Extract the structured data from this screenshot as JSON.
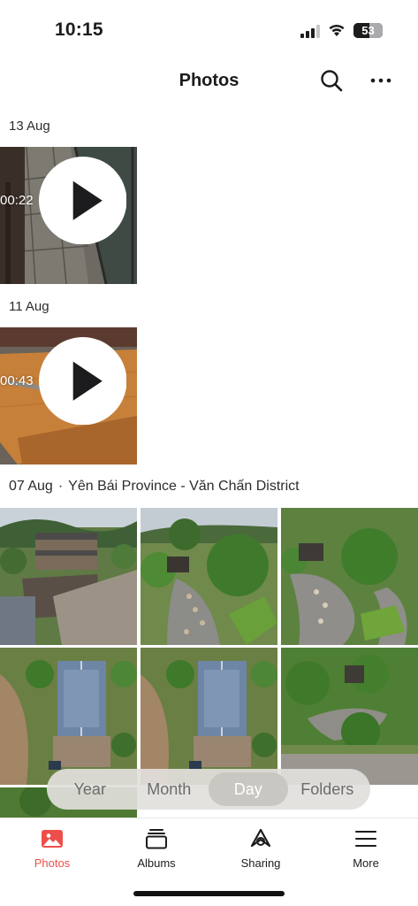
{
  "status_bar": {
    "time": "10:15",
    "battery": "53"
  },
  "header": {
    "title": "Photos"
  },
  "sections": [
    {
      "date": "13 Aug",
      "location": "",
      "video_duration": "00:22"
    },
    {
      "date": "11 Aug",
      "location": "",
      "video_duration": "00:43"
    },
    {
      "date": "07 Aug",
      "separator": "·",
      "location": "Yên Bái Province - Văn Chấn District"
    }
  ],
  "segmented": {
    "options": [
      "Year",
      "Month",
      "Day",
      "Folders"
    ],
    "selected": "Day"
  },
  "tab_bar": {
    "items": [
      "Photos",
      "Albums",
      "Sharing",
      "More"
    ],
    "active": "Photos"
  },
  "colors": {
    "accent": "#ee4e4a"
  }
}
